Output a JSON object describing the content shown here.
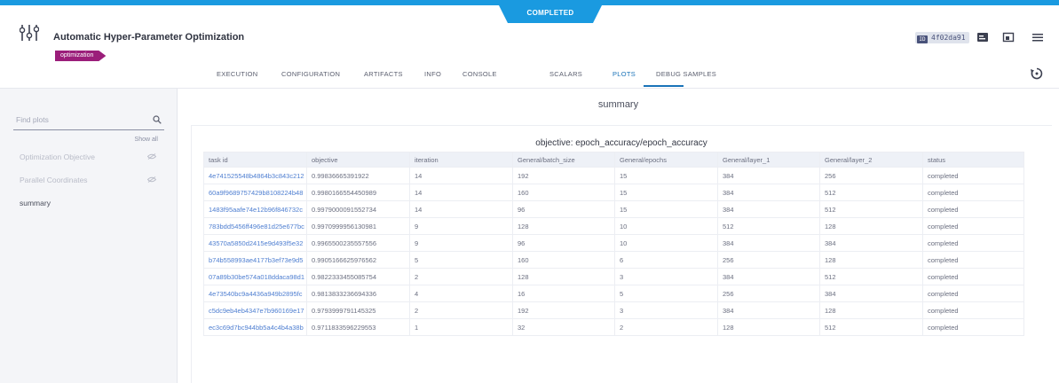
{
  "status_badge": "COMPLETED",
  "header": {
    "title": "Automatic Hyper-Parameter Optimization",
    "tag": "optimization",
    "task_id": "4f02da91",
    "id_icon_label": "ID"
  },
  "tabs": [
    {
      "label": "EXECUTION",
      "active": false
    },
    {
      "label": "CONFIGURATION",
      "active": false
    },
    {
      "label": "ARTIFACTS",
      "active": false
    },
    {
      "label": "INFO",
      "active": false
    },
    {
      "label": "CONSOLE",
      "active": false
    },
    {
      "label": "SCALARS",
      "active": false
    },
    {
      "label": "PLOTS",
      "active": true
    },
    {
      "label": "DEBUG SAMPLES",
      "active": false
    }
  ],
  "sidebar": {
    "search_placeholder": "Find plots",
    "show_all": "Show all",
    "items": [
      {
        "label": "Optimization Objective",
        "active": false
      },
      {
        "label": "Parallel Coordinates",
        "active": false
      },
      {
        "label": "summary",
        "active": true
      }
    ]
  },
  "main": {
    "title": "summary",
    "table_title": "objective: epoch_accuracy/epoch_accuracy",
    "columns": [
      "task id",
      "objective",
      "iteration",
      "General/batch_size",
      "General/epochs",
      "General/layer_1",
      "General/layer_2",
      "status"
    ],
    "rows": [
      [
        "4e741525548b4864b3c843c212",
        "0.99836665391922",
        "14",
        "192",
        "15",
        "384",
        "256",
        "completed"
      ],
      [
        "60a9f9689757429b8108224b48",
        "0.9980166554450989",
        "14",
        "160",
        "15",
        "384",
        "512",
        "completed"
      ],
      [
        "1483f95aafe74e12b96f846732c",
        "0.9979000091552734",
        "14",
        "96",
        "15",
        "384",
        "512",
        "completed"
      ],
      [
        "783bdd5456ff496e81d25e677bc",
        "0.9970999956130981",
        "9",
        "128",
        "10",
        "512",
        "128",
        "completed"
      ],
      [
        "43570a5850d2415e9d493f5e32",
        "0.9965500235557556",
        "9",
        "96",
        "10",
        "384",
        "384",
        "completed"
      ],
      [
        "b74b558993ae4177b3ef73e9d5",
        "0.9905166625976562",
        "5",
        "160",
        "6",
        "256",
        "128",
        "completed"
      ],
      [
        "07a89b30be574a018ddaca98d1",
        "0.9822333455085754",
        "2",
        "128",
        "3",
        "384",
        "512",
        "completed"
      ],
      [
        "4e73540bc9a4436a949b2895fc",
        "0.9813833236694336",
        "4",
        "16",
        "5",
        "256",
        "384",
        "completed"
      ],
      [
        "c5dc9eb4eb4347e7b960169e17",
        "0.9793999791145325",
        "2",
        "192",
        "3",
        "384",
        "128",
        "completed"
      ],
      [
        "ec3c69d7bc944bb5a4c4b4a38b",
        "0.9711833596229553",
        "1",
        "32",
        "2",
        "128",
        "512",
        "completed"
      ]
    ]
  }
}
